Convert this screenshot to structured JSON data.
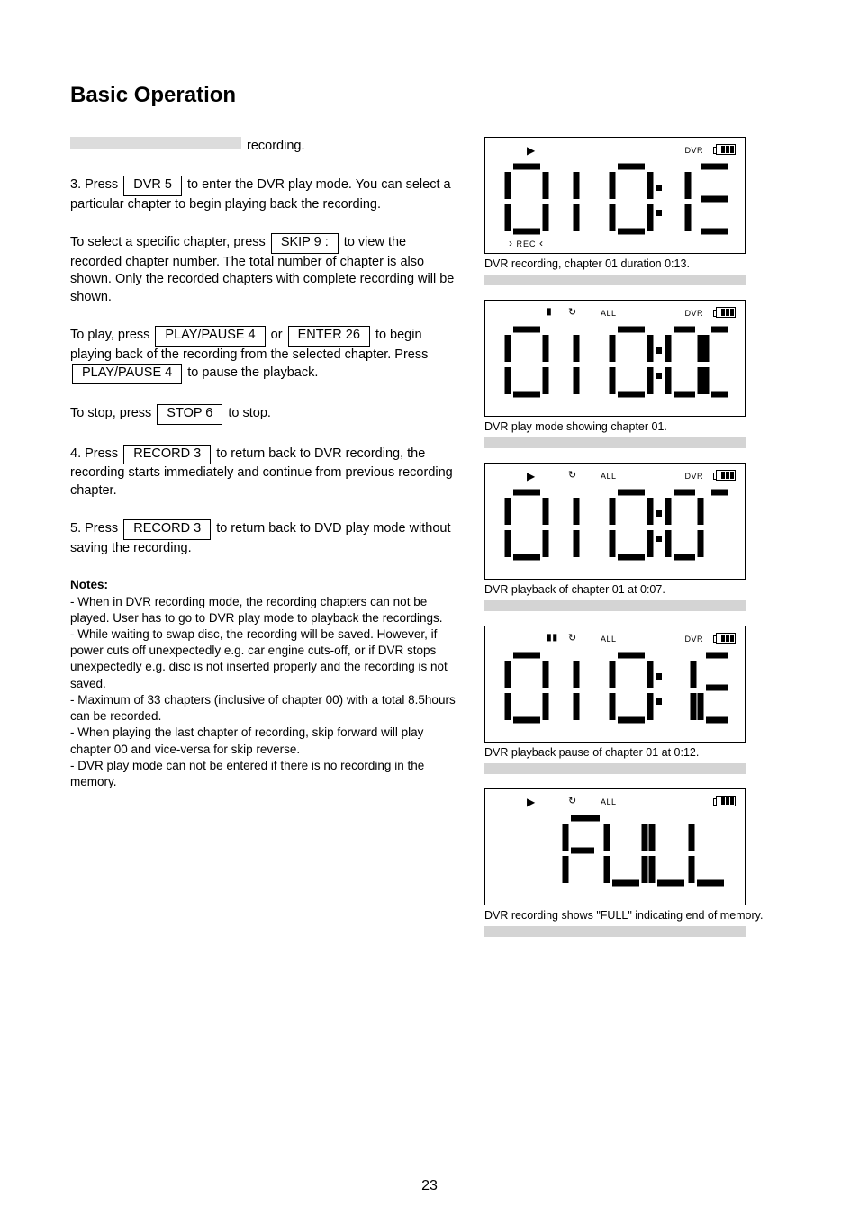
{
  "title": "Basic Operation",
  "page_number": "23",
  "left": {
    "intro_line": "recording.",
    "step3": {
      "p1_before_key": "3. Press ",
      "key1": "DVR 5",
      "p1_after_key": " to enter the DVR play mode. You can select a particular chapter to begin playing back the recording.",
      "p2_before_key": "To select a specific chapter, press ",
      "key2": "SKIP 9 :",
      "p2_after_key": " to view the recorded chapter number. The total number of chapter is also shown. Only the recorded chapters with complete recording will be shown.",
      "play_before_key1": "To play, press ",
      "key3": "PLAY/PAUSE 4",
      "play_mid1": " or ",
      "key4": "ENTER 26",
      "play_after_key1": " to begin playing back of the recording from the selected chapter. Press ",
      "key5": "PLAY/PAUSE 4",
      "play_pause_tail": " to pause the playback.",
      "stop_text": "To stop, press ",
      "key6": "STOP 6",
      "stop_tail": " to stop.",
      "p4_before_key": "4. Press ",
      "key7": "RECORD 3",
      "p4_after_key": " to return back to DVR recording, the recording starts immediately and continue from previous recording chapter.",
      "p5_before_key": "5. Press ",
      "key8": "RECORD 3",
      "p5_after_key": " to return back to DVD play mode without saving the recording."
    },
    "notes_head": "Notes:",
    "notes": [
      "- When in DVR recording mode, the recording chapters can not be played. User has to go to DVR play mode to playback the recordings.",
      "- While waiting to swap disc, the recording will be saved. However, if power cuts off unexpectedly e.g. car engine cuts-off, or if DVR stops unexpectedly e.g. disc is not inserted properly and the recording is not saved.",
      "- Maximum of 33 chapters (inclusive of chapter 00) with a total 8.5hours can be recorded.",
      "- When playing the last chapter of recording, skip forward will play chapter 00 and vice-versa for skip reverse.",
      "- DVR play mode can not be entered if there is no recording in the memory."
    ]
  },
  "lcd": [
    {
      "indicators": {
        "play": true,
        "pause": false,
        "loop": false,
        "all": false,
        "dvr": true,
        "batt": 3,
        "rec": true
      },
      "digits": [
        "0",
        "1",
        " ",
        "0",
        "13"
      ],
      "display_left": "01",
      "display_right": "0:13",
      "caption": "DVR recording, chapter 01 duration 0:13."
    },
    {
      "indicators": {
        "play": false,
        "pause": true,
        "loop": true,
        "all": true,
        "dvr": true,
        "batt": 3,
        "rec": false
      },
      "display_left": "01",
      "display_right": "0:00",
      "caption": "DVR play mode showing chapter 01."
    },
    {
      "indicators": {
        "play": true,
        "pause": false,
        "loop": true,
        "all": true,
        "dvr": true,
        "batt": 3,
        "rec": false
      },
      "display_left": "01",
      "display_right": "0:07",
      "caption": "DVR playback of chapter 01 at 0:07."
    },
    {
      "indicators": {
        "play": false,
        "pause": true,
        "loop": true,
        "all": true,
        "dvr": true,
        "batt": 3,
        "rec": false
      },
      "display_left": "01",
      "display_right": "0:12",
      "caption": "DVR playback pause of chapter 01 at 0:12."
    },
    {
      "indicators": {
        "play": true,
        "pause": false,
        "loop": true,
        "all": true,
        "dvr": false,
        "batt": 3,
        "rec": false
      },
      "display_text": "FULL",
      "caption": "DVR recording shows \"FULL\" indicating end of memory."
    }
  ],
  "glyphs": {
    "play": "▶",
    "pause": "▮▮",
    "loop": "↻",
    "all": "ALL",
    "dvr": "DVR"
  }
}
